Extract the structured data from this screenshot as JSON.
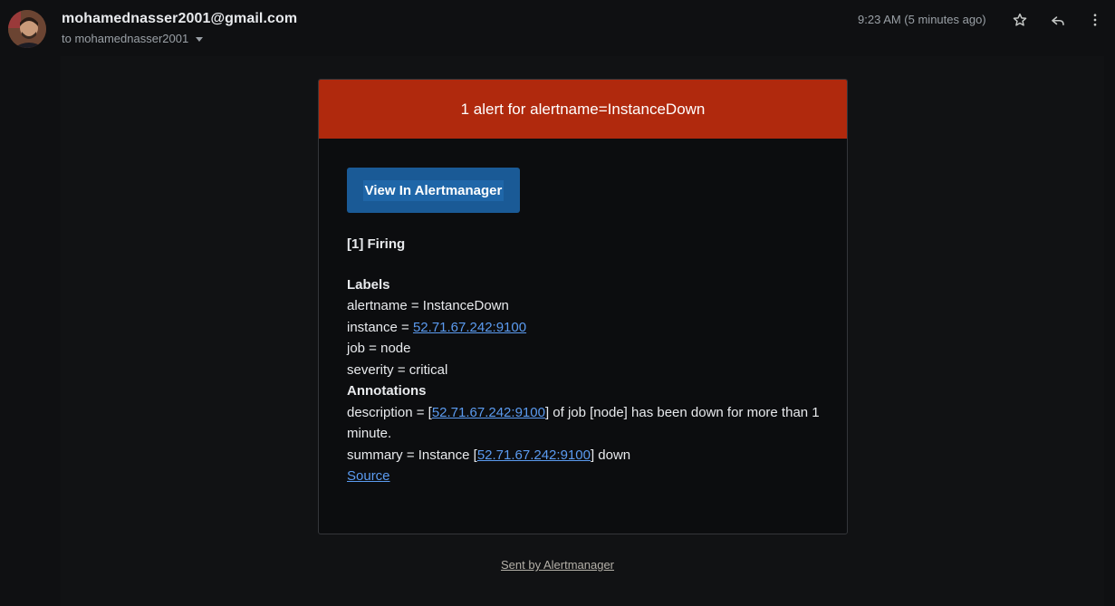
{
  "header": {
    "sender": "mohamednasser2001@gmail.com",
    "to_line": "to mohamednasser2001",
    "time": "9:23 AM (5 minutes ago)",
    "icons": [
      "star-icon",
      "reply-icon",
      "more-vert-icon"
    ]
  },
  "card": {
    "title": "1 alert for alertname=InstanceDown",
    "button_label": "View In Alertmanager",
    "firing": "[1] Firing",
    "labels_heading": "Labels",
    "alertname_line": "alertname = InstanceDown",
    "instance_prefix": "instance = ",
    "instance_link": "52.71.67.242:9100",
    "job_line": "job = node",
    "severity_line": "severity = critical",
    "annotations_heading": "Annotations",
    "description_prefix": "description = [",
    "description_link": "52.71.67.242:9100",
    "description_suffix": "] of job [node] has been down for more than 1 minute.",
    "summary_prefix": "summary = Instance [",
    "summary_link": "52.71.67.242:9100",
    "summary_suffix": "] down",
    "source_link": "Source"
  },
  "footer": {
    "sent_by": "Sent by Alertmanager"
  },
  "colors": {
    "header_red": "#b0290d",
    "button_blue": "#1a5a96",
    "link_blue": "#5b9bf0",
    "background": "#0f1012"
  }
}
